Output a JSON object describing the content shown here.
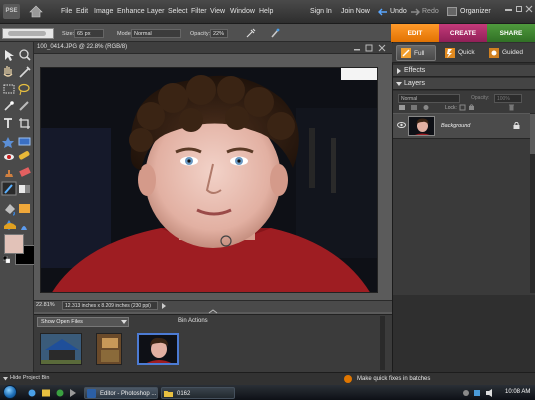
{
  "menubar": {
    "logo": "PSE",
    "items": [
      "File",
      "Edit",
      "Image",
      "Enhance",
      "Layer",
      "Select",
      "Filter",
      "View",
      "Window",
      "Help"
    ],
    "sign_in": "Sign In",
    "join_now": "Join Now",
    "undo": "Undo",
    "redo": "Redo",
    "organizer": "Organizer"
  },
  "options": {
    "size_label": "Size:",
    "size_value": "65 px",
    "mode_label": "Mode:",
    "mode_value": "Normal",
    "opacity_label": "Opacity:",
    "opacity_value": "22%"
  },
  "mode_tabs": {
    "edit": "EDIT",
    "create": "CREATE",
    "share": "SHARE"
  },
  "edit_modes": {
    "full": "Full",
    "quick": "Quick",
    "guided": "Guided"
  },
  "document": {
    "title": "100_0414.JPG @ 22.8% (RGB/8)",
    "zoom": "22.81%",
    "size_info": "12.313 inches x 8.209 inches (230 ppi)"
  },
  "project_bin": {
    "show_select": "Show Open Files",
    "bin_actions": "Bin Actions",
    "hide_bin": "Hide Project Bin"
  },
  "palettes": {
    "effects": "Effects",
    "layers": "Layers",
    "blend_mode": "Normal",
    "opacity_label": "Opacity:",
    "opacity_value": "100%",
    "lock_label": "Lock:",
    "layer_name": "Background"
  },
  "status": {
    "quick_fix_message": "Make quick fixes in batches"
  },
  "taskbar": {
    "editor_task": "Editor - Photoshop ...",
    "folder_task": "0162",
    "time": "10:08 AM"
  },
  "colors": {
    "edit_tab": "#f07d10",
    "create_tab": "#a82a66",
    "share_tab": "#3f8a30",
    "foreground_swatch": "#e2c2b8",
    "background_swatch": "#000000",
    "selection_blue": "#4c7bd4"
  }
}
